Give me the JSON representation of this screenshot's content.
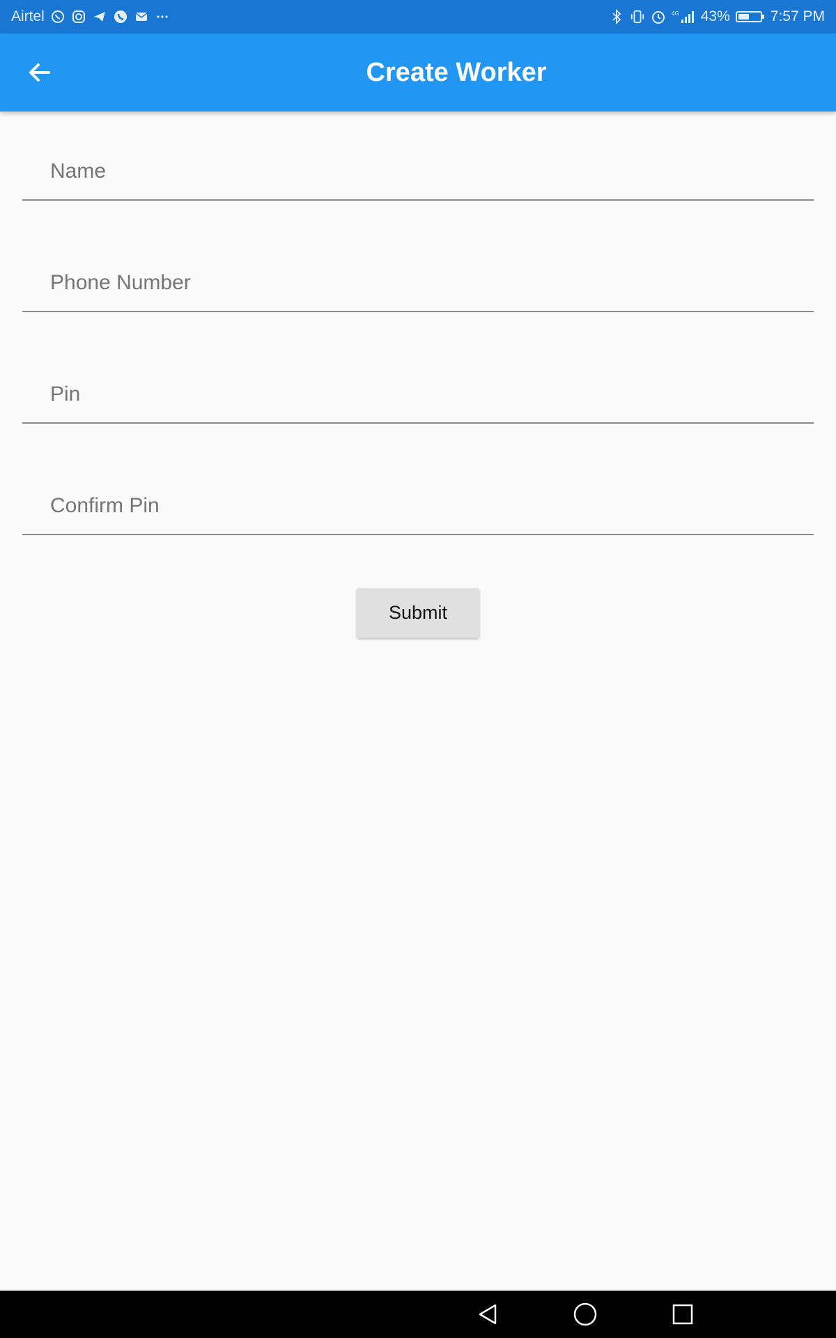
{
  "status_bar": {
    "carrier": "Airtel",
    "battery_percent": "43%",
    "time": "7:57 PM",
    "network": "4G",
    "left_icons": [
      "whatsapp-icon",
      "instagram-icon",
      "telegram-icon",
      "phone-icon",
      "mail-icon",
      "more-dots-icon"
    ],
    "right_icons": [
      "bluetooth-icon",
      "vibrate-icon",
      "alarm-icon",
      "signal-icon",
      "battery-icon"
    ]
  },
  "app_bar": {
    "title": "Create Worker",
    "back_icon": "arrow-back-icon",
    "background": "#2196f3"
  },
  "form": {
    "name_placeholder": "Name",
    "name_value": "",
    "phone_placeholder": "Phone Number",
    "phone_value": "",
    "pin_placeholder": "Pin",
    "pin_value": "",
    "confirm_pin_placeholder": "Confirm Pin",
    "confirm_pin_value": "",
    "submit_label": "Submit"
  },
  "nav_bar": {
    "icons": [
      "back-triangle-icon",
      "home-circle-icon",
      "recents-square-icon"
    ]
  }
}
